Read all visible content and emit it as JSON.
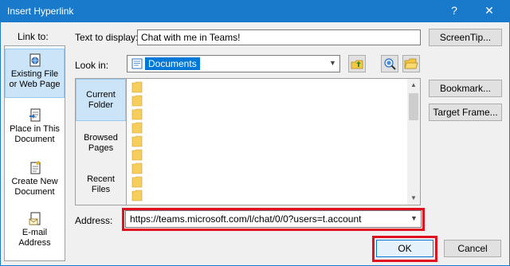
{
  "window": {
    "title": "Insert Hyperlink",
    "help_label": "?",
    "close_label": "✕",
    "accent_color": "#1979ca"
  },
  "link_to": {
    "label": "Link to:",
    "items": [
      {
        "label_line1": "Existing File",
        "label_line2": "or Web Page",
        "icon": "web-page-icon",
        "selected": true
      },
      {
        "label_line1": "Place in This",
        "label_line2": "Document",
        "icon": "place-in-document-icon",
        "selected": false
      },
      {
        "label_line1": "Create New",
        "label_line2": "Document",
        "icon": "new-document-icon",
        "selected": false
      },
      {
        "label_line1": "E-mail",
        "label_line2": "Address",
        "icon": "email-icon",
        "selected": false
      }
    ]
  },
  "text_to_display": {
    "label": "Text to display:",
    "value": "Chat with me in Teams!"
  },
  "screentip_button": "ScreenTip...",
  "look_in": {
    "label": "Look in:",
    "value": "Documents"
  },
  "browse": {
    "items": [
      {
        "line1": "Current",
        "line2": "Folder",
        "selected": true
      },
      {
        "line1": "Browsed",
        "line2": "Pages",
        "selected": false
      },
      {
        "line1": "Recent",
        "line2": "Files",
        "selected": false
      }
    ]
  },
  "right_buttons": {
    "bookmark": "Bookmark...",
    "target_frame": "Target Frame..."
  },
  "address": {
    "label": "Address:",
    "value": "https://teams.microsoft.com/l/chat/0/0?users=t.account"
  },
  "footer": {
    "ok": "OK",
    "cancel": "Cancel"
  },
  "highlight_color": "#e0101e"
}
